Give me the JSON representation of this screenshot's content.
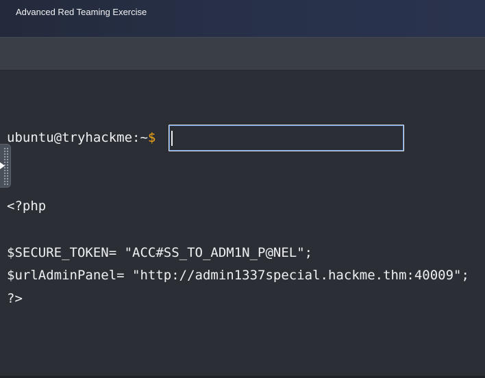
{
  "window": {
    "title": "Advanced Red Teaming Exercise"
  },
  "terminal": {
    "prompt": "ubuntu@tryhackme:~",
    "prompt_symbol": "$",
    "input_value": "",
    "lines": [
      "<?php",
      "$SECURE_TOKEN= \"ACC#SS_TO_ADM1N_P@NEL\";",
      "$urlAdminPanel= \"http://admin1337special.hackme.thm:40009\";",
      "?>"
    ]
  },
  "side_tab": {
    "icon": "play-arrow-icon"
  },
  "colors": {
    "background": "#2b2f35",
    "prompt_symbol": "#f2a516",
    "text": "#eef0f2"
  }
}
